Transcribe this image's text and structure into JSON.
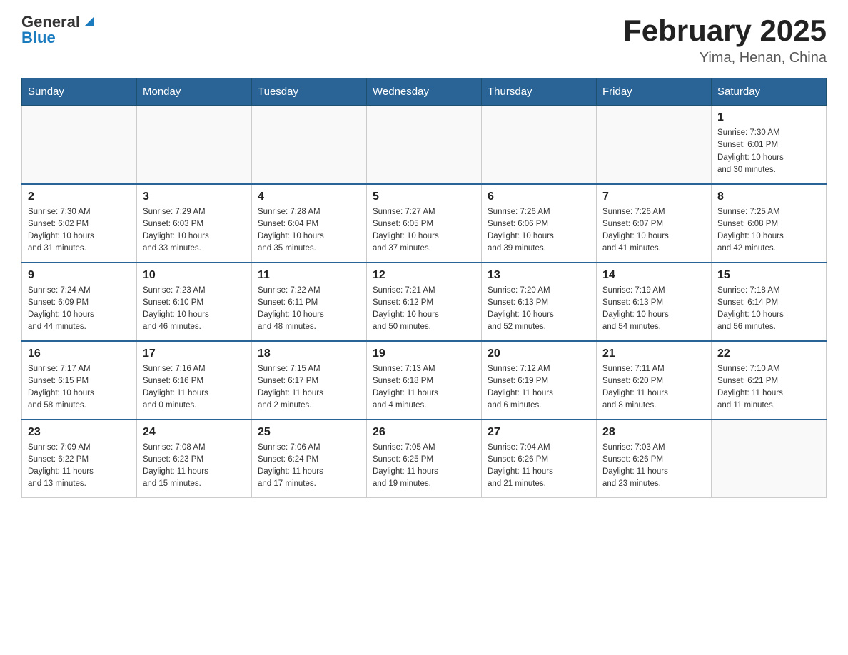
{
  "header": {
    "logo": {
      "general": "General",
      "blue": "Blue"
    },
    "title": "February 2025",
    "subtitle": "Yima, Henan, China"
  },
  "calendar": {
    "days_of_week": [
      "Sunday",
      "Monday",
      "Tuesday",
      "Wednesday",
      "Thursday",
      "Friday",
      "Saturday"
    ],
    "weeks": [
      [
        {
          "day": "",
          "info": ""
        },
        {
          "day": "",
          "info": ""
        },
        {
          "day": "",
          "info": ""
        },
        {
          "day": "",
          "info": ""
        },
        {
          "day": "",
          "info": ""
        },
        {
          "day": "",
          "info": ""
        },
        {
          "day": "1",
          "info": "Sunrise: 7:30 AM\nSunset: 6:01 PM\nDaylight: 10 hours\nand 30 minutes."
        }
      ],
      [
        {
          "day": "2",
          "info": "Sunrise: 7:30 AM\nSunset: 6:02 PM\nDaylight: 10 hours\nand 31 minutes."
        },
        {
          "day": "3",
          "info": "Sunrise: 7:29 AM\nSunset: 6:03 PM\nDaylight: 10 hours\nand 33 minutes."
        },
        {
          "day": "4",
          "info": "Sunrise: 7:28 AM\nSunset: 6:04 PM\nDaylight: 10 hours\nand 35 minutes."
        },
        {
          "day": "5",
          "info": "Sunrise: 7:27 AM\nSunset: 6:05 PM\nDaylight: 10 hours\nand 37 minutes."
        },
        {
          "day": "6",
          "info": "Sunrise: 7:26 AM\nSunset: 6:06 PM\nDaylight: 10 hours\nand 39 minutes."
        },
        {
          "day": "7",
          "info": "Sunrise: 7:26 AM\nSunset: 6:07 PM\nDaylight: 10 hours\nand 41 minutes."
        },
        {
          "day": "8",
          "info": "Sunrise: 7:25 AM\nSunset: 6:08 PM\nDaylight: 10 hours\nand 42 minutes."
        }
      ],
      [
        {
          "day": "9",
          "info": "Sunrise: 7:24 AM\nSunset: 6:09 PM\nDaylight: 10 hours\nand 44 minutes."
        },
        {
          "day": "10",
          "info": "Sunrise: 7:23 AM\nSunset: 6:10 PM\nDaylight: 10 hours\nand 46 minutes."
        },
        {
          "day": "11",
          "info": "Sunrise: 7:22 AM\nSunset: 6:11 PM\nDaylight: 10 hours\nand 48 minutes."
        },
        {
          "day": "12",
          "info": "Sunrise: 7:21 AM\nSunset: 6:12 PM\nDaylight: 10 hours\nand 50 minutes."
        },
        {
          "day": "13",
          "info": "Sunrise: 7:20 AM\nSunset: 6:13 PM\nDaylight: 10 hours\nand 52 minutes."
        },
        {
          "day": "14",
          "info": "Sunrise: 7:19 AM\nSunset: 6:13 PM\nDaylight: 10 hours\nand 54 minutes."
        },
        {
          "day": "15",
          "info": "Sunrise: 7:18 AM\nSunset: 6:14 PM\nDaylight: 10 hours\nand 56 minutes."
        }
      ],
      [
        {
          "day": "16",
          "info": "Sunrise: 7:17 AM\nSunset: 6:15 PM\nDaylight: 10 hours\nand 58 minutes."
        },
        {
          "day": "17",
          "info": "Sunrise: 7:16 AM\nSunset: 6:16 PM\nDaylight: 11 hours\nand 0 minutes."
        },
        {
          "day": "18",
          "info": "Sunrise: 7:15 AM\nSunset: 6:17 PM\nDaylight: 11 hours\nand 2 minutes."
        },
        {
          "day": "19",
          "info": "Sunrise: 7:13 AM\nSunset: 6:18 PM\nDaylight: 11 hours\nand 4 minutes."
        },
        {
          "day": "20",
          "info": "Sunrise: 7:12 AM\nSunset: 6:19 PM\nDaylight: 11 hours\nand 6 minutes."
        },
        {
          "day": "21",
          "info": "Sunrise: 7:11 AM\nSunset: 6:20 PM\nDaylight: 11 hours\nand 8 minutes."
        },
        {
          "day": "22",
          "info": "Sunrise: 7:10 AM\nSunset: 6:21 PM\nDaylight: 11 hours\nand 11 minutes."
        }
      ],
      [
        {
          "day": "23",
          "info": "Sunrise: 7:09 AM\nSunset: 6:22 PM\nDaylight: 11 hours\nand 13 minutes."
        },
        {
          "day": "24",
          "info": "Sunrise: 7:08 AM\nSunset: 6:23 PM\nDaylight: 11 hours\nand 15 minutes."
        },
        {
          "day": "25",
          "info": "Sunrise: 7:06 AM\nSunset: 6:24 PM\nDaylight: 11 hours\nand 17 minutes."
        },
        {
          "day": "26",
          "info": "Sunrise: 7:05 AM\nSunset: 6:25 PM\nDaylight: 11 hours\nand 19 minutes."
        },
        {
          "day": "27",
          "info": "Sunrise: 7:04 AM\nSunset: 6:26 PM\nDaylight: 11 hours\nand 21 minutes."
        },
        {
          "day": "28",
          "info": "Sunrise: 7:03 AM\nSunset: 6:26 PM\nDaylight: 11 hours\nand 23 minutes."
        },
        {
          "day": "",
          "info": ""
        }
      ]
    ]
  }
}
